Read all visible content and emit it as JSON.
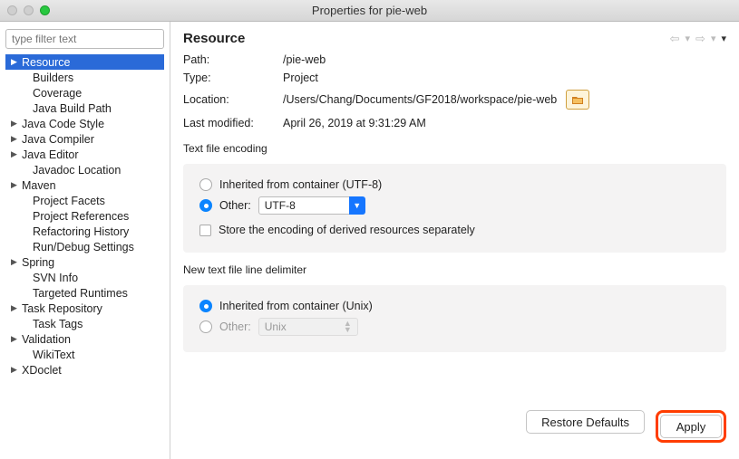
{
  "window": {
    "title": "Properties for pie-web"
  },
  "sidebar": {
    "filter_placeholder": "type filter text",
    "items": [
      {
        "label": "Resource",
        "arrow": true,
        "selected": true,
        "level": 0
      },
      {
        "label": "Builders",
        "arrow": false,
        "selected": false,
        "level": 1
      },
      {
        "label": "Coverage",
        "arrow": false,
        "selected": false,
        "level": 1
      },
      {
        "label": "Java Build Path",
        "arrow": false,
        "selected": false,
        "level": 1
      },
      {
        "label": "Java Code Style",
        "arrow": true,
        "selected": false,
        "level": 0
      },
      {
        "label": "Java Compiler",
        "arrow": true,
        "selected": false,
        "level": 0
      },
      {
        "label": "Java Editor",
        "arrow": true,
        "selected": false,
        "level": 0
      },
      {
        "label": "Javadoc Location",
        "arrow": false,
        "selected": false,
        "level": 1
      },
      {
        "label": "Maven",
        "arrow": true,
        "selected": false,
        "level": 0
      },
      {
        "label": "Project Facets",
        "arrow": false,
        "selected": false,
        "level": 1
      },
      {
        "label": "Project References",
        "arrow": false,
        "selected": false,
        "level": 1
      },
      {
        "label": "Refactoring History",
        "arrow": false,
        "selected": false,
        "level": 1
      },
      {
        "label": "Run/Debug Settings",
        "arrow": false,
        "selected": false,
        "level": 1
      },
      {
        "label": "Spring",
        "arrow": true,
        "selected": false,
        "level": 0
      },
      {
        "label": "SVN Info",
        "arrow": false,
        "selected": false,
        "level": 1
      },
      {
        "label": "Targeted Runtimes",
        "arrow": false,
        "selected": false,
        "level": 1
      },
      {
        "label": "Task Repository",
        "arrow": true,
        "selected": false,
        "level": 0
      },
      {
        "label": "Task Tags",
        "arrow": false,
        "selected": false,
        "level": 1
      },
      {
        "label": "Validation",
        "arrow": true,
        "selected": false,
        "level": 0
      },
      {
        "label": "WikiText",
        "arrow": false,
        "selected": false,
        "level": 1
      },
      {
        "label": "XDoclet",
        "arrow": true,
        "selected": false,
        "level": 0
      }
    ]
  },
  "page": {
    "heading": "Resource",
    "path_label": "Path:",
    "path_value": "/pie-web",
    "type_label": "Type:",
    "type_value": "Project",
    "location_label": "Location:",
    "location_value": "/Users/Chang/Documents/GF2018/workspace/pie-web",
    "lastmod_label": "Last modified:",
    "lastmod_value": "April 26, 2019 at 9:31:29 AM",
    "encoding": {
      "title": "Text file encoding",
      "inherited_label": "Inherited from container (UTF-8)",
      "other_label": "Other:",
      "other_value": "UTF-8",
      "store_derived_label": "Store the encoding of derived resources separately"
    },
    "delimiter": {
      "title": "New text file line delimiter",
      "inherited_label": "Inherited from container (Unix)",
      "other_label": "Other:",
      "other_value": "Unix"
    },
    "buttons": {
      "restore": "Restore Defaults",
      "apply": "Apply"
    }
  }
}
